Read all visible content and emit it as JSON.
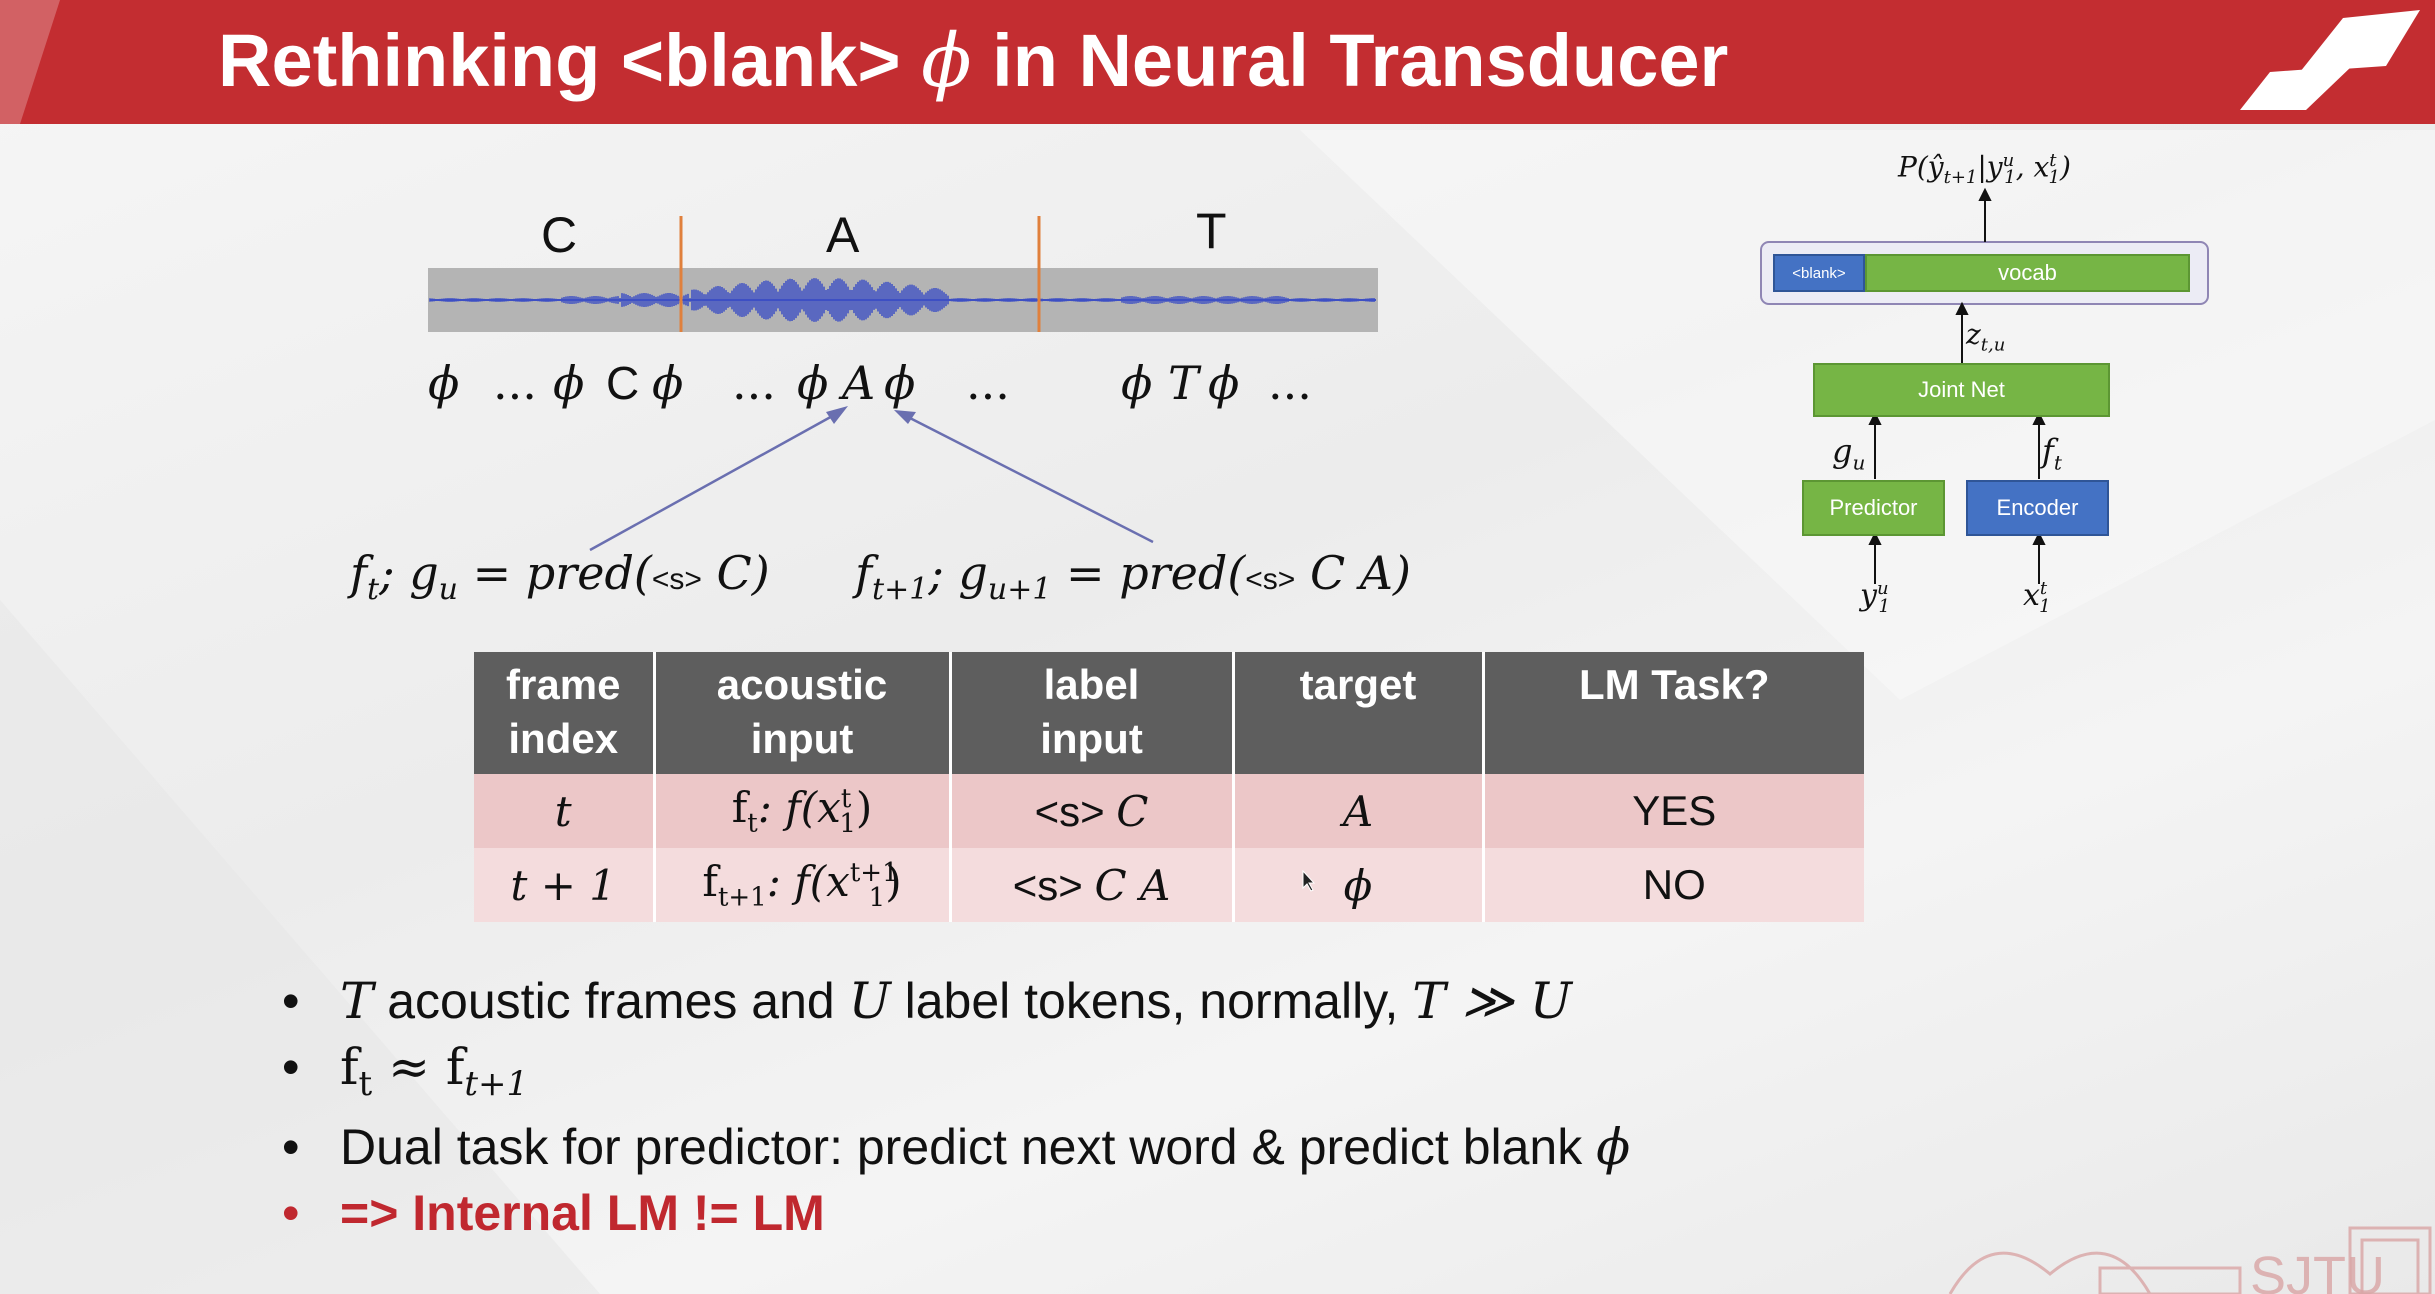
{
  "title": {
    "prefix": "Rethinking <blank>",
    "phi": "ϕ",
    "suffix": "in Neural Transducer"
  },
  "alignment": {
    "letters": [
      "C",
      "A",
      "T"
    ],
    "blank_sequence": [
      {
        "text": "ϕ",
        "italic": true
      },
      {
        "text": "...",
        "italic": false
      },
      {
        "text": "ϕ",
        "italic": true
      },
      {
        "text": "C",
        "italic": false
      },
      {
        "text": "ϕ",
        "italic": true
      },
      {
        "text": "...",
        "italic": false
      },
      {
        "text": "ϕ",
        "italic": true
      },
      {
        "text": "A",
        "italic": true
      },
      {
        "text": "ϕ",
        "italic": true
      },
      {
        "text": "...",
        "italic": false
      },
      {
        "text": "ϕ",
        "italic": true
      },
      {
        "text": "T",
        "italic": true
      },
      {
        "text": "ϕ",
        "italic": true
      },
      {
        "text": "...",
        "italic": false
      }
    ],
    "formula_left": {
      "pre": "f",
      "sub_t": "t",
      "mid": "; g",
      "sub_u": "u",
      "eq": " = pred(",
      "s": "<s>",
      "arg": " C)"
    },
    "formula_right": {
      "pre": "f",
      "sub_t": "t+1",
      "mid": "; g",
      "sub_u": "u+1",
      "eq": " = pred(",
      "s": "<s>",
      "arg": "  C A)"
    }
  },
  "architecture": {
    "output": "P(ŷ",
    "output_sub": "t+1",
    "output_mid": "|y",
    "output_sup1": "u",
    "output_sub1": "1",
    "output_mid2": ", x",
    "output_sup2": "t",
    "output_sub2": "1",
    "output_end": ")",
    "blank_label": "<blank>",
    "vocab_label": "vocab",
    "z_label": "z",
    "z_sub": "t,u",
    "joint_label": "Joint Net",
    "g_label": "g",
    "g_sub": "u",
    "f_label": "f",
    "f_sub": "t",
    "predictor_label": "Predictor",
    "encoder_label": "Encoder",
    "y_label": "y",
    "y_sup": "u",
    "y_sub": "1",
    "x_label": "x",
    "x_sup": "t",
    "x_sub": "1",
    "colors": {
      "green": "#76b545",
      "blue": "#4472c4"
    }
  },
  "table": {
    "headers": [
      [
        "frame",
        "index"
      ],
      [
        "acoustic",
        "input"
      ],
      [
        "label",
        "input"
      ],
      [
        "target",
        ""
      ],
      [
        "LM Task?",
        ""
      ]
    ],
    "rows": [
      {
        "frame": "t",
        "acoustic_f": "f",
        "acoustic_f_sub": "t",
        "acoustic_rest": ":   f(x",
        "acoustic_sup": "t",
        "acoustic_sub": "1",
        "acoustic_end": ")",
        "label": "<s> ",
        "label_it": "C",
        "target": "A",
        "lm": "YES"
      },
      {
        "frame": "t + 1",
        "acoustic_f": "f",
        "acoustic_f_sub": "t+1",
        "acoustic_rest": ": f(x",
        "acoustic_sup": "t+1",
        "acoustic_sub": "1",
        "acoustic_end": ")",
        "label": "<s> ",
        "label_it": "C A",
        "target": "ϕ",
        "lm": "NO"
      }
    ],
    "colors": {
      "header": "#5e5e5e",
      "row1": "#ecc7c8",
      "row2": "#f4dcdd",
      "yes": "#6aa84f",
      "no": "#c62828"
    }
  },
  "bullets": {
    "b1_T": "T",
    "b1_a": " acoustic frames and ",
    "b1_U": "U",
    "b1_b": " label tokens, normally, ",
    "b1_rel": "T ≫ U",
    "b2_f": "f",
    "b2_sub": "t",
    "b2_approx": "  ≈ f",
    "b2_sub2": "t+1",
    "b3": "Dual task for predictor: predict next word & predict blank ",
    "b3_phi": "ϕ",
    "b4": "=> Internal LM != LM"
  },
  "logo_text": "SJTU"
}
